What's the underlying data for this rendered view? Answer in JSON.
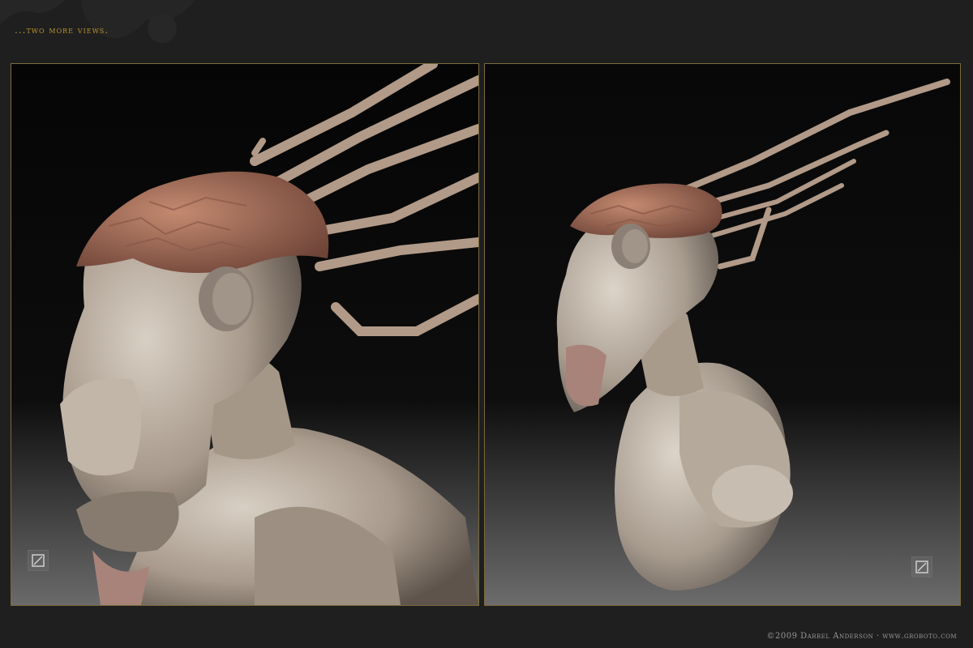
{
  "header": {
    "caption": "...two more views."
  },
  "footer": {
    "credit": "©2009 Darrel Anderson · www.groboto.com"
  },
  "colors": {
    "accent_gold": "#b8942e",
    "page_bg": "#1f1f1f",
    "frame_border": "#7a6a3a",
    "skin": "#b9ab9c",
    "crown": "#a86a55"
  },
  "images": [
    {
      "subject": "creature-bust-side-view",
      "icon": "groboto-logo-icon"
    },
    {
      "subject": "creature-bust-three-quarter-view",
      "icon": "groboto-logo-icon"
    }
  ]
}
